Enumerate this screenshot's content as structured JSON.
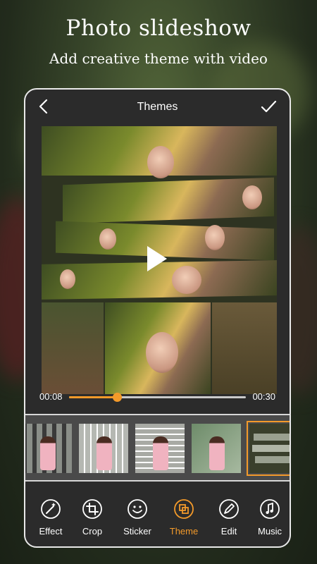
{
  "headline": {
    "title": "Photo slideshow",
    "subtitle": "Add creative theme with video"
  },
  "editor": {
    "title": "Themes",
    "back_icon": "chevron-left-icon",
    "done_icon": "check-icon"
  },
  "player": {
    "current_time": "00:08",
    "total_time": "00:30",
    "progress": 0.27
  },
  "themes": {
    "selected_index": 4,
    "count": 5
  },
  "tools": [
    {
      "label": "Effect",
      "icon": "magic-wand-icon"
    },
    {
      "label": "Crop",
      "icon": "crop-icon"
    },
    {
      "label": "Sticker",
      "icon": "smiley-icon"
    },
    {
      "label": "Theme",
      "icon": "theme-icon",
      "active": true
    },
    {
      "label": "Edit",
      "icon": "pencil-icon"
    },
    {
      "label": "Music",
      "icon": "music-note-icon"
    }
  ],
  "colors": {
    "accent": "#f39a2a",
    "panel": "#2b2b2b",
    "text": "#ffffff"
  }
}
